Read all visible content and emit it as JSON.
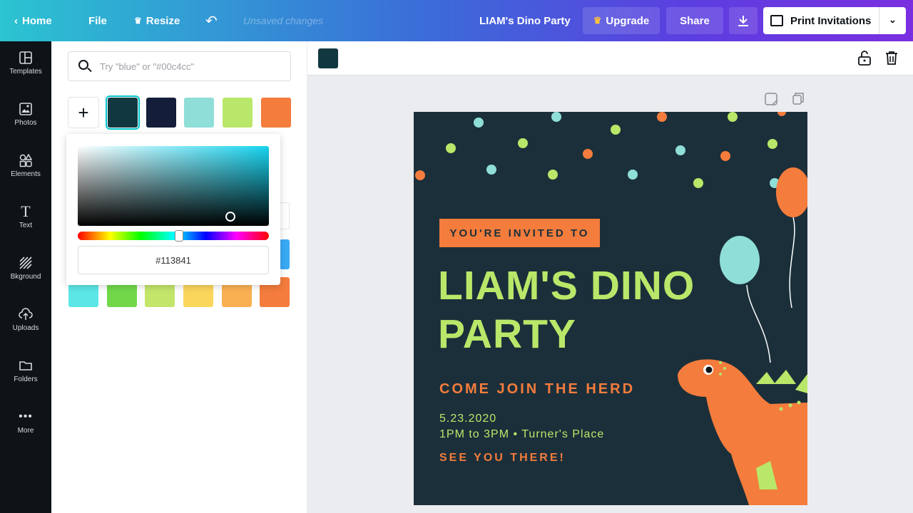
{
  "topbar": {
    "home_label": "Home",
    "file_label": "File",
    "resize_label": "Resize",
    "unsaved_label": "Unsaved changes",
    "doc_title": "LIAM's Dino Party",
    "upgrade_label": "Upgrade",
    "share_label": "Share",
    "print_label": "Print Invitations"
  },
  "nav": {
    "items": [
      {
        "label": "Templates",
        "icon": "templates-icon"
      },
      {
        "label": "Photos",
        "icon": "photos-icon"
      },
      {
        "label": "Elements",
        "icon": "elements-icon"
      },
      {
        "label": "Text",
        "icon": "text-icon"
      },
      {
        "label": "Bkground",
        "icon": "background-icon"
      },
      {
        "label": "Uploads",
        "icon": "uploads-icon"
      },
      {
        "label": "Folders",
        "icon": "folders-icon"
      },
      {
        "label": "More",
        "icon": "more-icon"
      }
    ]
  },
  "panel": {
    "search_placeholder": "Try \"blue\" or \"#00c4cc\"",
    "document_colors": [
      "#113841",
      "#141e3a",
      "#8fded7",
      "#b9e769",
      "#f47c3c"
    ],
    "bottom_row_colors": [
      "#5ce6e6",
      "#72d84a",
      "#c3e56a",
      "#fad65c",
      "#f9b052",
      "#f47c3c"
    ]
  },
  "picker": {
    "hex_value": "#113841",
    "hue_position": 0.53
  },
  "canvas_toolbar": {
    "selected_color": "#113841"
  },
  "design": {
    "invite_label": "YOU'RE INVITED TO",
    "headline_line1": "LIAM'S DINO",
    "headline_line2": "PARTY",
    "herd_label": "COME JOIN THE HERD",
    "date_label": "5.23.2020",
    "time_label": "1PM to 3PM • Turner's  Place",
    "see_label": "SEE YOU THERE!",
    "colors": {
      "background": "#1b2f3a",
      "orange": "#f47c3c",
      "green": "#b9e769",
      "aqua": "#8fded7"
    }
  }
}
